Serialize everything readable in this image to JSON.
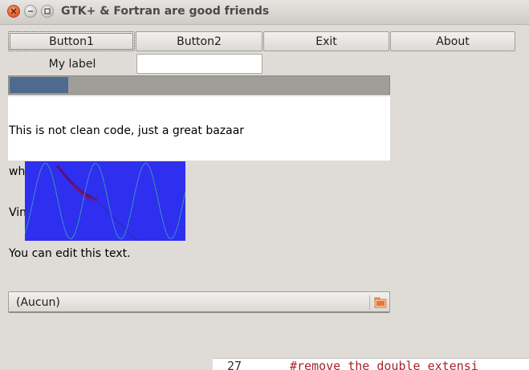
{
  "window": {
    "title": "GTK+ & Fortran are good friends"
  },
  "toolbar": {
    "buttons": [
      {
        "label": "Button1",
        "focused": true
      },
      {
        "label": "Button2"
      },
      {
        "label": "Exit"
      },
      {
        "label": "About"
      }
    ]
  },
  "form": {
    "label": "My label",
    "entry_value": ""
  },
  "progress": {
    "fraction": 0.155,
    "fill_color": "#4e6b8d",
    "trough_color": "#a09e99"
  },
  "textview": {
    "lines": [
      "This is not clean code, just a great bazaar",
      "where I test widgets",
      "Vincent",
      "You can edit this text."
    ]
  },
  "drawing": {
    "background_color": "#2f2ff0",
    "curve_color": "#3fd0a0"
  },
  "file_chooser": {
    "selected": "(Aucun)",
    "icon": "folder-open-icon"
  },
  "background_window": {
    "line_number": "27",
    "code": "#remove the double extensi"
  }
}
